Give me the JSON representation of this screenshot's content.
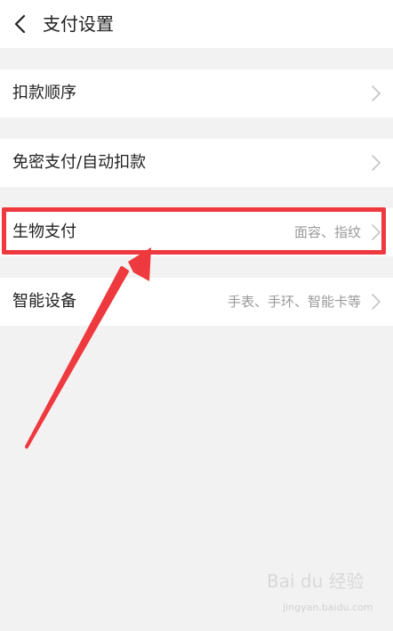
{
  "header": {
    "title": "支付设置"
  },
  "rows": [
    {
      "label": "扣款顺序",
      "value": ""
    },
    {
      "label": "免密支付/自动扣款",
      "value": ""
    },
    {
      "label": "生物支付",
      "value": "面容、指纹"
    },
    {
      "label": "智能设备",
      "value": "手表、手环、智能卡等"
    }
  ],
  "watermark": {
    "logo": "Bai du 经验",
    "url": "jingyan.baidu.com"
  },
  "colors": {
    "background": "#f2f2f2",
    "annotation": "#ee3a3f"
  }
}
